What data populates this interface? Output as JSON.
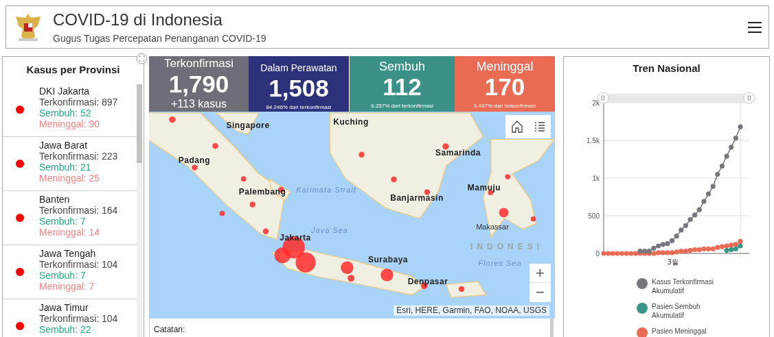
{
  "header": {
    "title": "COVID-19 di Indonesia",
    "subtitle": "Gugus Tugas Percepatan Penanganan COVID-19"
  },
  "provinces_panel": {
    "title": "Kasus per Provinsi",
    "items": [
      {
        "name": "DKI Jakarta",
        "confirmed": "Terkonfirmasi: 897",
        "recovered": "Sembuh: 52",
        "deaths": "Meninggal: 90"
      },
      {
        "name": "Jawa Barat",
        "confirmed": "Terkonfirmasi: 223",
        "recovered": "Sembuh: 21",
        "deaths": "Meninggal: 25"
      },
      {
        "name": "Banten",
        "confirmed": "Terkonfirmasi: 164",
        "recovered": "Sembuh: 7",
        "deaths": "Meninggal: 14"
      },
      {
        "name": "Jawa Tengah",
        "confirmed": "Terkonfirmasi: 104",
        "recovered": "Sembuh: 7",
        "deaths": "Meninggal: 7"
      },
      {
        "name": "Jawa Timur",
        "confirmed": "Terkonfirmasi: 104",
        "recovered": "Sembuh: 22"
      }
    ]
  },
  "stats": [
    {
      "kind": "confirmed",
      "title": "Terkonfirmasi",
      "value": "1,790",
      "note": "+113 kasus"
    },
    {
      "kind": "treated",
      "title": "Dalam Perawatan",
      "value": "1,508",
      "note": "84.246% dari terkonfirmasi"
    },
    {
      "kind": "recovered",
      "title": "Sembuh",
      "value": "112",
      "note": "6.257% dari terkonfirmasi"
    },
    {
      "kind": "deaths",
      "title": "Meninggal",
      "value": "170",
      "note": "9.497% dari terkonfirmasi"
    }
  ],
  "map": {
    "labels": [
      {
        "kind": "city",
        "text": "Singapore"
      },
      {
        "kind": "city",
        "text": "Kuching"
      },
      {
        "kind": "city",
        "text": "Samarinda"
      },
      {
        "kind": "city",
        "text": "Padang"
      },
      {
        "kind": "city",
        "text": "Palembang"
      },
      {
        "kind": "water",
        "text": "Karimata Strait"
      },
      {
        "kind": "city",
        "text": "Banjarmasin"
      },
      {
        "kind": "city",
        "text": "Mamuju"
      },
      {
        "kind": "water",
        "text": "Java Sea"
      },
      {
        "kind": "small",
        "text": "Makassar"
      },
      {
        "kind": "country",
        "text": "INDONESI"
      },
      {
        "kind": "city",
        "text": "Jakarta"
      },
      {
        "kind": "city",
        "text": "Surabaya"
      },
      {
        "kind": "water",
        "text": "Flores Sea"
      },
      {
        "kind": "city",
        "text": "Denpasar"
      }
    ],
    "zoom_in": "+",
    "zoom_out": "−",
    "attribution": "Esri, HERE, Garmin, FAO, NOAA, USGS"
  },
  "notes": {
    "label": "Catatan:"
  },
  "trend": {
    "title": "Tren Nasional",
    "chart_data": {
      "type": "line",
      "xlabel": "3월",
      "grid": true,
      "ylim": [
        0,
        2000
      ],
      "yticks": [
        {
          "value": 0,
          "label": "0"
        },
        {
          "value": 500,
          "label": "500"
        },
        {
          "value": 1000,
          "label": "1k"
        },
        {
          "value": 1500,
          "label": "1.5k"
        },
        {
          "value": 2000,
          "label": "2k"
        }
      ],
      "series": [
        {
          "name": "Kasus Terkonfirmasi Akumulatif",
          "color": "#76767e",
          "marker": "circle",
          "values": [
            null,
            null,
            null,
            null,
            null,
            null,
            null,
            null,
            30,
            30,
            30,
            70,
            100,
            120,
            130,
            170,
            230,
            310,
            370,
            450,
            510,
            580,
            690,
            790,
            890,
            1050,
            1160,
            1290,
            1410,
            1530,
            1680
          ]
        },
        {
          "name": "Pasien Sembuh Akumulatif",
          "color": "#3a9488",
          "marker": "circle",
          "values": [
            null,
            null,
            null,
            null,
            null,
            null,
            null,
            null,
            null,
            null,
            null,
            null,
            null,
            null,
            null,
            null,
            null,
            null,
            null,
            null,
            null,
            null,
            null,
            null,
            null,
            null,
            null,
            40,
            50,
            60,
            100
          ]
        },
        {
          "name": "Pasien Meninggal",
          "color": "#e96b53",
          "marker": "circle",
          "values": [
            0,
            0,
            0,
            0,
            0,
            0,
            0,
            0,
            0,
            0,
            0,
            0,
            10,
            10,
            10,
            10,
            20,
            30,
            30,
            40,
            50,
            50,
            60,
            60,
            60,
            80,
            90,
            100,
            110,
            120,
            160
          ]
        }
      ]
    }
  }
}
